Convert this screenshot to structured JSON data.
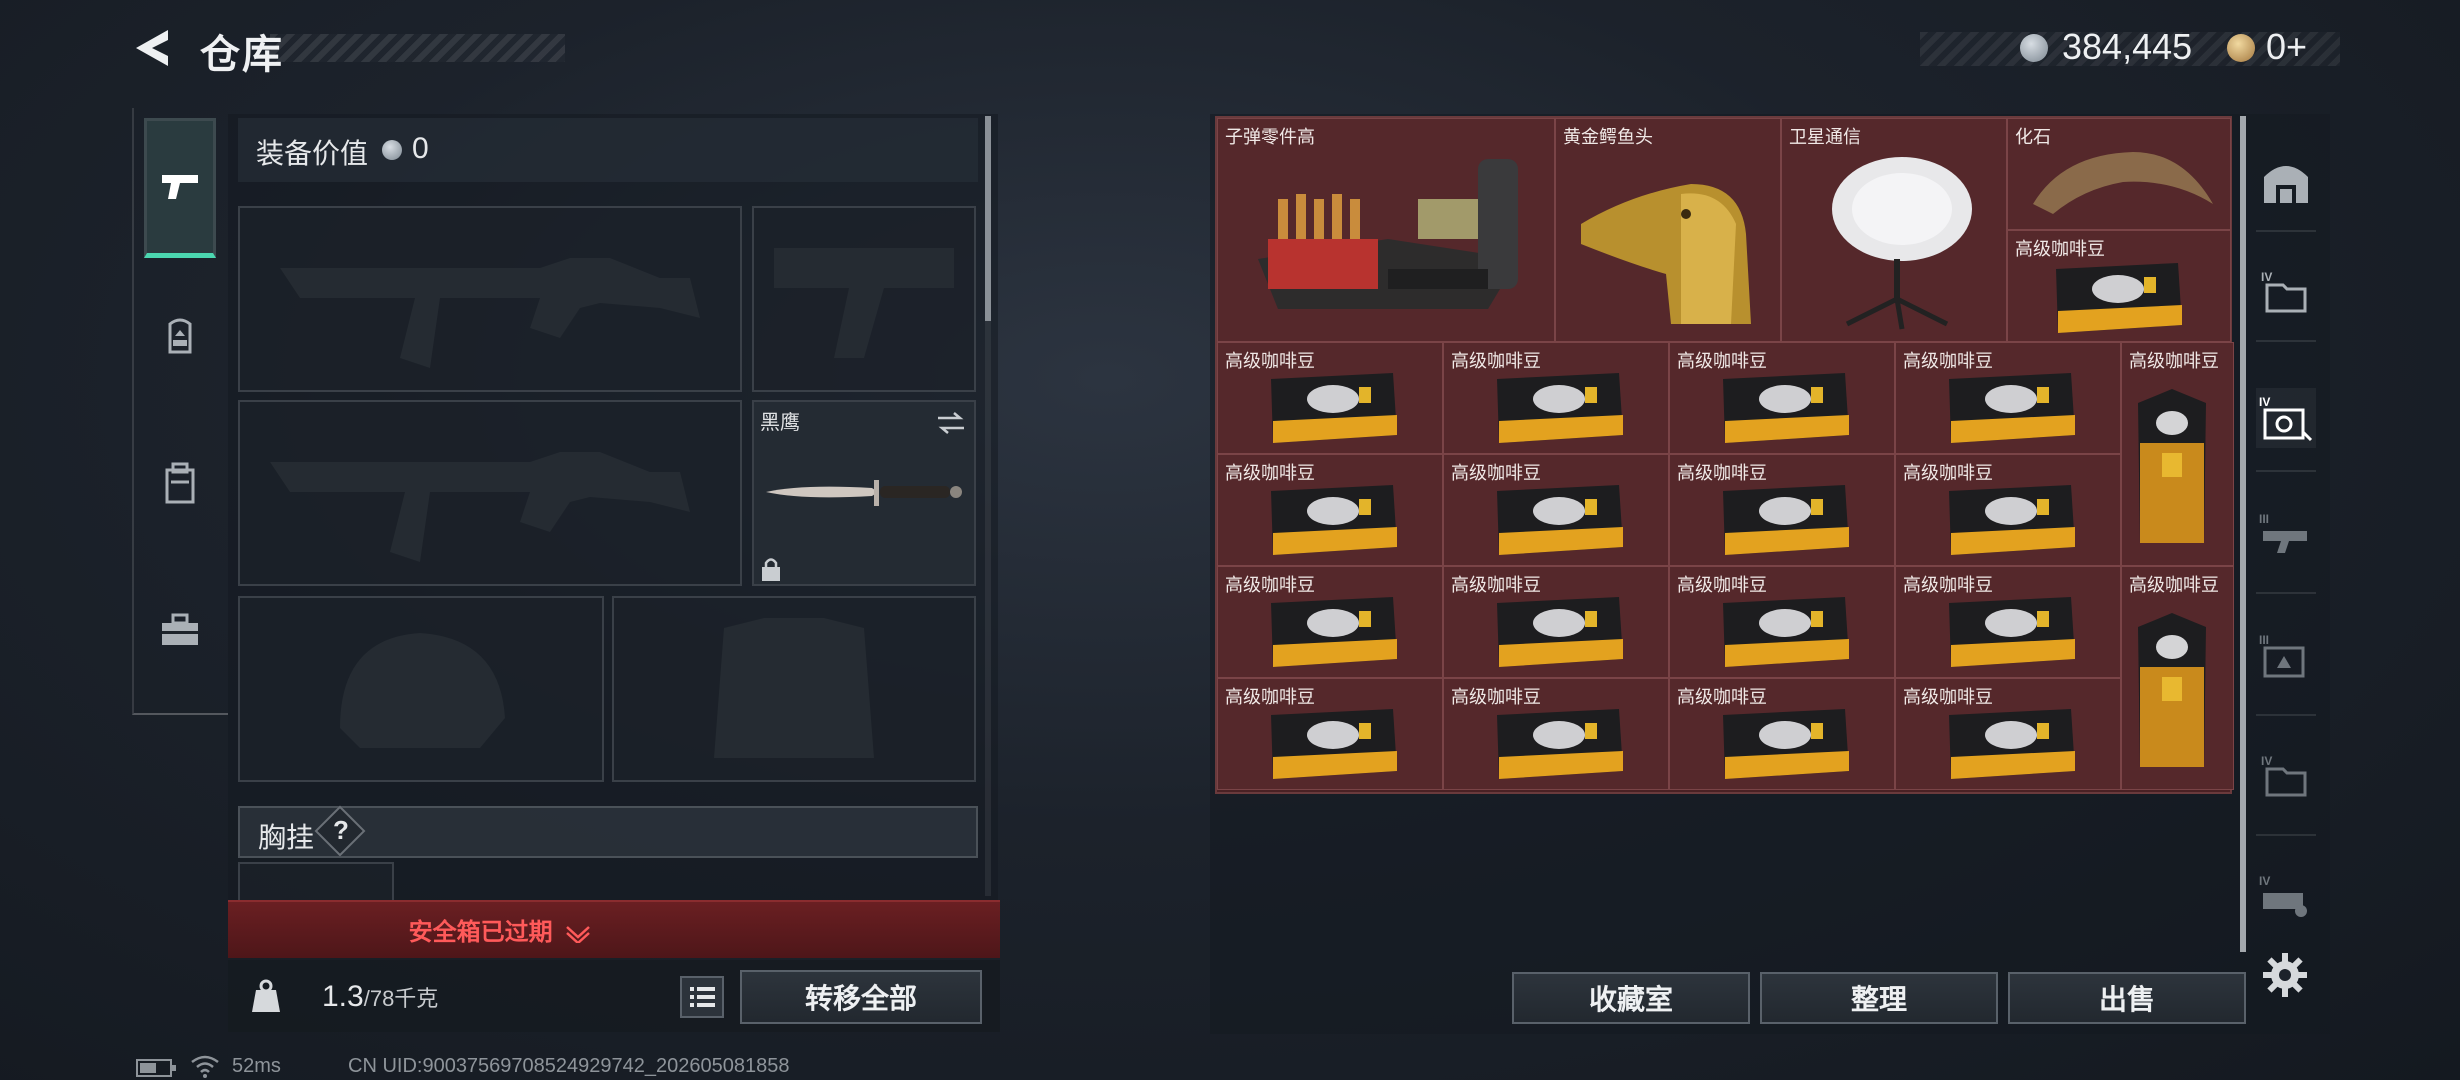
{
  "header": {
    "title": "仓库",
    "currency_silver": "384,445",
    "currency_gold": "0+"
  },
  "left": {
    "value_label": "装备价值",
    "value_amount": "0",
    "knife_name": "黑鹰",
    "chest_label": "胸挂",
    "chest_help": "?",
    "safebox_text": "安全箱已过期",
    "weight_value": "1.3",
    "weight_capacity": "/78千克",
    "transfer_all": "转移全部"
  },
  "right": {
    "items": [
      {
        "label": "子弹零件高"
      },
      {
        "label": "黄金鳄鱼头"
      },
      {
        "label": "卫星通信"
      },
      {
        "label": "化石"
      },
      {
        "label": "高级咖啡豆"
      }
    ],
    "coffee_label": "高级咖啡豆",
    "buttons": {
      "collection": "收藏室",
      "sort": "整理",
      "sell": "出售"
    }
  },
  "status": {
    "ping": "52ms",
    "uid": "CN UID:900375697085249297​42_202605081858"
  }
}
